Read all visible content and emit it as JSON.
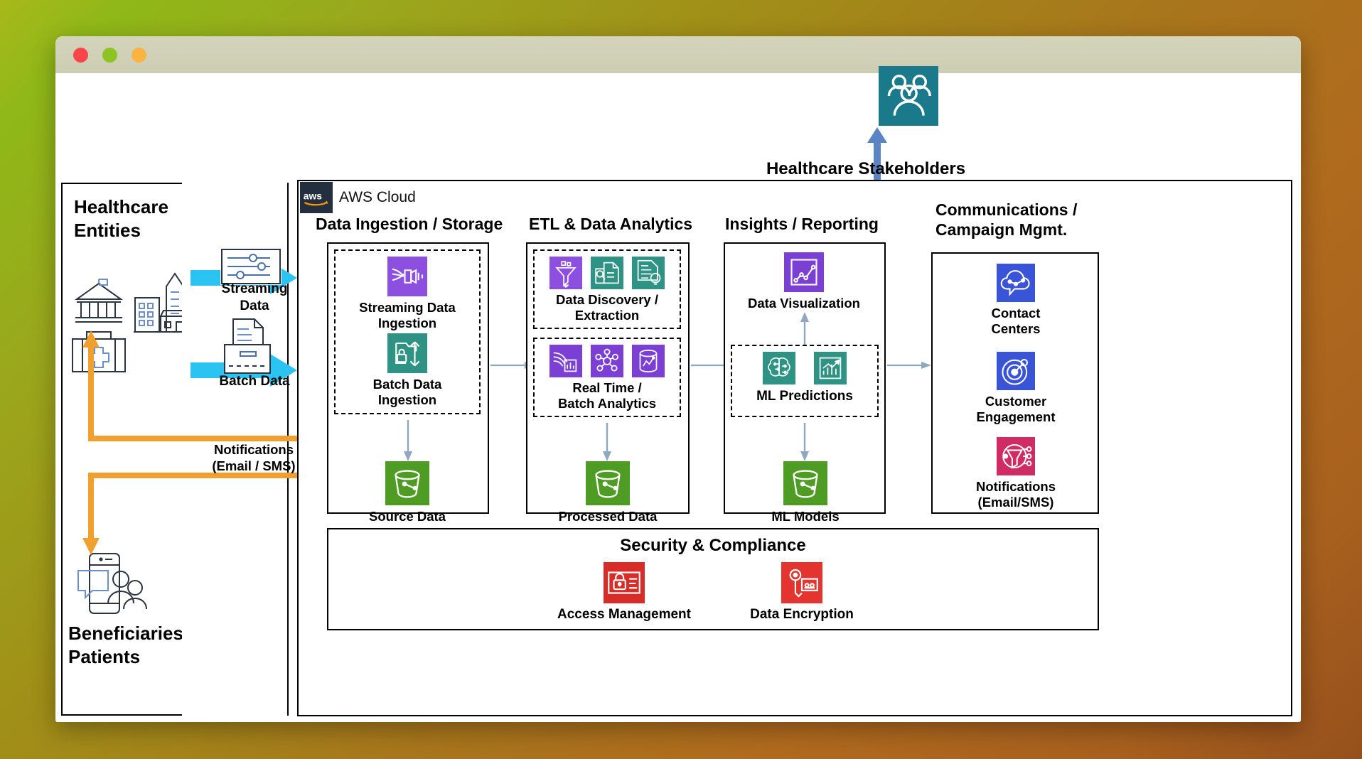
{
  "window": {
    "traffic_lights": [
      "close",
      "minimize",
      "maximize"
    ]
  },
  "stakeholders": {
    "label": "Healthcare  Stakeholders",
    "icon": "users-icon",
    "color": "#1A7A8C"
  },
  "aws_cloud": {
    "label": "AWS Cloud",
    "logo": "aws-logo"
  },
  "left_panel": {
    "title": "Healthcare\nEntities",
    "icons": [
      "government-building-icon",
      "office-buildings-icon",
      "medical-kit-icon"
    ],
    "bottom_title": "Beneficiaries /\nPatients",
    "bottom_icon": "mobile-people-icon"
  },
  "flows": {
    "streaming": {
      "label": "Streaming\nData",
      "icon": "streaming-sliders-icon",
      "color": "#2BC4F2"
    },
    "batch": {
      "label": "Batch Data",
      "icon": "file-drawer-icon",
      "color": "#2BC4F2"
    },
    "notifications": {
      "label": "Notifications\n(Email / SMS)",
      "color": "#EFA02E"
    }
  },
  "columns": [
    {
      "title": "Data Ingestion / Storage",
      "groups": [
        {
          "style": "dashed",
          "nodes": [
            {
              "label": "Streaming Data\nIngestion",
              "icon": "kinesis-streaming-icon",
              "color": "#8C4FE0"
            },
            {
              "label": "Batch Data\nIngestion",
              "icon": "datasync-batch-icon",
              "color": "#2E9384"
            }
          ]
        }
      ],
      "storage": {
        "label": "Source Data",
        "icon": "s3-bucket-icon",
        "color": "#4E9C23"
      }
    },
    {
      "title": "ETL & Data Analytics",
      "groups": [
        {
          "style": "dashed",
          "label": "Data Discovery /\nExtraction",
          "icons": [
            {
              "name": "glue-funnel-icon",
              "color": "#8C4FE0"
            },
            {
              "name": "textract-doc-icon",
              "color": "#2E9384"
            },
            {
              "name": "comprehend-doc-icon",
              "color": "#2E9384"
            }
          ]
        },
        {
          "style": "dashed",
          "label": "Real Time /\nBatch Analytics",
          "icons": [
            {
              "name": "emr-analytics-icon",
              "color": "#7B3FD4"
            },
            {
              "name": "glue-nodes-icon",
              "color": "#7B3FD4"
            },
            {
              "name": "redshift-db-icon",
              "color": "#7B3FD4"
            }
          ]
        }
      ],
      "storage": {
        "label": "Processed Data",
        "icon": "s3-bucket-icon",
        "color": "#4E9C23"
      }
    },
    {
      "title": "Insights /  Reporting",
      "groups": [
        {
          "style": "none",
          "nodes": [
            {
              "label": "Data Visualization",
              "icon": "quicksight-chart-icon",
              "color": "#7B3FD4"
            }
          ]
        },
        {
          "style": "dashed",
          "label": "ML  Predictions",
          "icons": [
            {
              "name": "sagemaker-brain-icon",
              "color": "#2E9384"
            },
            {
              "name": "forecast-chart-icon",
              "color": "#2E9384"
            }
          ]
        }
      ],
      "storage": {
        "label": "ML Models",
        "icon": "s3-bucket-icon",
        "color": "#4E9C23"
      }
    },
    {
      "title": "Communications /\nCampaign Mgmt.",
      "nodes": [
        {
          "label": "Contact\nCenters",
          "icon": "connect-cloud-icon",
          "color": "#3A54D8"
        },
        {
          "label": "Customer\nEngagement",
          "icon": "pinpoint-target-icon",
          "color": "#3A54D8"
        },
        {
          "label": "Notifications\n(Email/SMS)",
          "icon": "sns-notify-icon",
          "color": "#D02B62"
        }
      ]
    }
  ],
  "security": {
    "title": "Security & Compliance",
    "items": [
      {
        "label": "Access Management",
        "icon": "iam-lock-icon",
        "color": "#D82C28"
      },
      {
        "label": "Data Encryption",
        "icon": "kms-key-icon",
        "color": "#E3342F"
      }
    ]
  }
}
